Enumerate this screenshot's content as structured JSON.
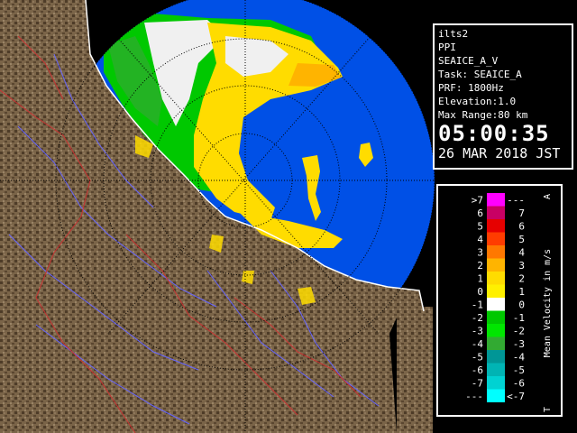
{
  "info": {
    "site": "ilts2",
    "mode": "PPI",
    "product": "SEAICE_A_V",
    "task": "Task: SEAICE_A",
    "prf": "PRF: 1800Hz",
    "elevation": "Elevation:1.0",
    "max_range": "Max Range:80 km",
    "time": "05:00:35",
    "date": "26 MAR 2018 JST"
  },
  "legend": {
    "title": "Mean Velocity in m/s",
    "corner_top": "A",
    "corner_bottom": "T",
    "rows": [
      {
        "left": ">7",
        "right": "---",
        "color": "#ff00ff"
      },
      {
        "left": "6",
        "right": "7",
        "color": "#c80064"
      },
      {
        "left": "5",
        "right": "6",
        "color": "#e60000"
      },
      {
        "left": "4",
        "right": "5",
        "color": "#ff3c00"
      },
      {
        "left": "3",
        "right": "4",
        "color": "#ff7800"
      },
      {
        "left": "2",
        "right": "3",
        "color": "#ffb400"
      },
      {
        "left": "1",
        "right": "2",
        "color": "#ffdc00"
      },
      {
        "left": "0",
        "right": "1",
        "color": "#fff000"
      },
      {
        "left": "-1",
        "right": "0",
        "color": "#ffffff"
      },
      {
        "left": "-2",
        "right": "-1",
        "color": "#00c800"
      },
      {
        "left": "-3",
        "right": "-2",
        "color": "#00e600"
      },
      {
        "left": "-4",
        "right": "-3",
        "color": "#32aa32"
      },
      {
        "left": "-5",
        "right": "-4",
        "color": "#009696"
      },
      {
        "left": "-6",
        "right": "-5",
        "color": "#00b4b4"
      },
      {
        "left": "-7",
        "right": "-6",
        "color": "#00d2d2"
      },
      {
        "left": "---",
        "right": "<-7",
        "color": "#00ffff"
      }
    ]
  },
  "colors": {
    "sea": "#0050e6",
    "outside": "#000000",
    "land": "#7a6448",
    "land_dark": "#4e3c28",
    "coast": "#ffffff",
    "river": "#6464ff",
    "boundary": "#c83232"
  }
}
